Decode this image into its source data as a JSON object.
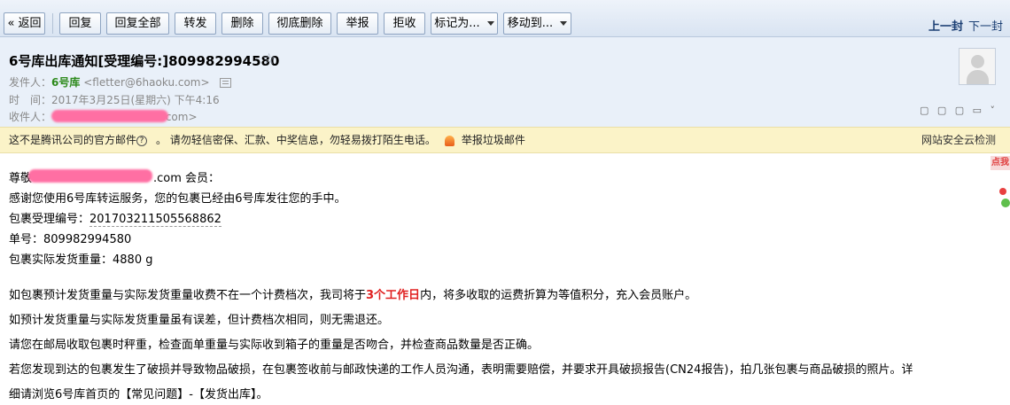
{
  "toolbar": {
    "back": "« 返回",
    "reply": "回复",
    "reply_all": "回复全部",
    "forward": "转发",
    "delete": "删除",
    "delete_perm": "彻底删除",
    "report": "举报",
    "reject": "拒收",
    "mark_as": "标记为...",
    "move_to": "移动到...",
    "prev": "上一封",
    "next": "下一封"
  },
  "header": {
    "subject": "6号库出库通知[受理编号:]809982994580",
    "from_label": "发件人：",
    "from_name": "6号库",
    "from_addr": "<fletter@6haoku.com>",
    "time_label": "时　间：",
    "time_value": "2017年3月25日(星期六) 下午4:16",
    "to_label": "收件人：",
    "to_tail": ".com>",
    "tool_icons": "▢ ▢ ▢ ▭ ˅"
  },
  "warning": {
    "text1": "这不是腾讯公司的官方邮件",
    "text2": "。 请勿轻信密保、汇款、中奖信息，勿轻易拨打陌生电话。",
    "report_label": "举报垃圾邮件",
    "right_label": "网站安全云检测"
  },
  "body": {
    "greeting_prefix": "尊敬",
    "greeting_suffix": ".com 会员：",
    "line1": "感谢您使用6号库转运服务，您的包裹已经由6号库发往您的手中。",
    "accept_label": "包裹受理编号：",
    "accept_no": "201703211505568862",
    "order_label": "单号：809982994580",
    "weight_label": "包裹实际发货重量：4880 g",
    "para1_a": "如包裹预计发货重量与实际发货重量收费不在一个计费档次，我司将于",
    "para1_hl": "3个工作日",
    "para1_b": "内，将多收取的运费折算为等值积分，充入会员账户。",
    "para2": "如预计发货重量与实际发货重量虽有误差，但计费档次相同，则无需退还。",
    "para3": "请您在邮局收取包裹时秤重，检查面单重量与实际收到箱子的重量是否吻合，并检查商品数量是否正确。",
    "para4": "若您发现到达的包裹发生了破损并导致物品破损，在包裹签收前与邮政快递的工作人员沟通，表明需要赔偿，并要求开具破损报告(CN24报告)，拍几张包裹与商品破损的照片。详",
    "para5": "细请浏览6号库首页的【常见问题】-【发货出库】。"
  },
  "side": {
    "tag": "点我"
  }
}
